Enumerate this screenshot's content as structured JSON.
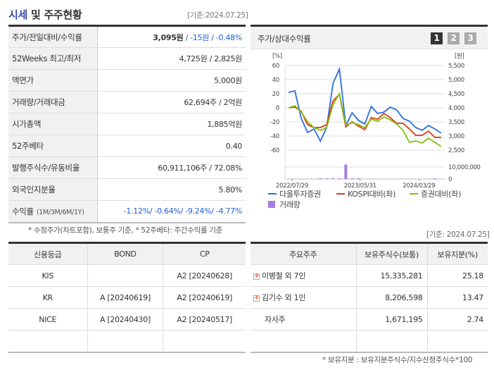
{
  "header": {
    "title_hl": "시세",
    "title_rest": " 및 주주현황",
    "date": "[기준:2024.07.25]"
  },
  "quote": [
    {
      "label": "주가/전일대비/수익률",
      "price": "3,095원",
      "rest": " / -15원 / -0.48%"
    },
    {
      "label": "52Weeks 최고/최저",
      "value": "4,725원 / 2,825원"
    },
    {
      "label": "액면가",
      "value": "5,000원"
    },
    {
      "label": "거래량/거래대금",
      "value": "62,694주 / 2억원"
    },
    {
      "label": "시가총액",
      "value": "1,885억원"
    },
    {
      "label": "52주베타",
      "value": "0.40"
    },
    {
      "label": "발행주식수/유동비율",
      "value": "60,911,106주 / 72.08%"
    },
    {
      "label": "외국인지분율",
      "value": "5.80%"
    },
    {
      "label": "수익률",
      "sub": "(1M/3M/6M/1Y)",
      "value": "-1.12%/ -0.64%/ -9.24%/ -4.77%"
    }
  ],
  "note1": "* 수정주가(차트포함), 보통주 기준, * 52주베타: 주간수익률 기준",
  "chart_panel": {
    "title": "주가/상대수익률",
    "pages": [
      "1",
      "2",
      "3"
    ],
    "active_page": "1"
  },
  "chart_data": {
    "type": "line",
    "left_unit": "[%]",
    "right_unit": "[원]",
    "left_ticks": [
      60,
      40,
      20,
      0,
      -20,
      -40,
      -60
    ],
    "right_ticks": [
      "5,500",
      "5,000",
      "4,500",
      "4,000",
      "3,500",
      "3,000",
      "2,500"
    ],
    "volume_ticks": [
      "10,000,000",
      "0"
    ],
    "ylim": [
      -60,
      60
    ],
    "x_labels": [
      "2022/07/29",
      "2023/05/31",
      "2024/03/29"
    ],
    "series": [
      {
        "name": "다올투자증권",
        "color": "#2a6de0",
        "values": [
          22,
          24,
          -15,
          -35,
          -30,
          -47,
          -28,
          35,
          55,
          -25,
          -7,
          -18,
          -23,
          2,
          -8,
          -6,
          1,
          -3,
          -15,
          -19,
          -28,
          -32,
          -25,
          -30,
          -36
        ]
      },
      {
        "name": "KOSPI대비(좌)",
        "color": "#d9380f",
        "values": [
          0,
          1,
          -5,
          -24,
          -28,
          -28,
          -24,
          10,
          19,
          -27,
          -20,
          -26,
          -31,
          -14,
          -16,
          -8,
          -14,
          -22,
          -22,
          -30,
          -39,
          -39,
          -33,
          -42,
          -42
        ]
      },
      {
        "name": "증권대비(좌)",
        "color": "#84c00c",
        "values": [
          0,
          3,
          -6,
          -20,
          -28,
          -32,
          -28,
          5,
          20,
          -25,
          -21,
          -24,
          -28,
          -16,
          -19,
          -13,
          -17,
          -23,
          -32,
          -49,
          -47,
          -50,
          -43,
          -49,
          -55
        ]
      }
    ],
    "volume": {
      "name": "거래량",
      "color": "#a57ee0",
      "values": [
        0,
        0,
        0,
        0,
        0,
        200000,
        200000,
        200000,
        200000,
        12000000,
        200000,
        200000,
        0,
        0,
        0,
        0,
        0,
        0,
        0,
        0,
        0,
        0,
        0,
        200000,
        0
      ]
    }
  },
  "date2": "[기준: 2024.07.25]",
  "credit": {
    "headers": [
      "신용등급",
      "BOND",
      "CP"
    ],
    "rows": [
      [
        "KIS",
        "",
        "A2 [20240628]"
      ],
      [
        "KR",
        "A [20240619]",
        "A2 [20240619]"
      ],
      [
        "NICE",
        "A [20240430]",
        "A2 [20240517]"
      ],
      [
        "",
        "",
        ""
      ]
    ]
  },
  "holders": {
    "headers": [
      "주요주주",
      "보유주식수(보통)",
      "보유지분(%)"
    ],
    "rows": [
      {
        "name": "이병철 외 7인",
        "expand": true,
        "shares": "15,335,281",
        "pct": "25.18"
      },
      {
        "name": "김기수 외 1인",
        "expand": true,
        "shares": "8,206,598",
        "pct": "13.47"
      },
      {
        "name": "자사주",
        "expand": false,
        "shares": "1,671,195",
        "pct": "2.74"
      },
      {
        "name": "",
        "expand": false,
        "shares": "",
        "pct": ""
      }
    ]
  },
  "note2": "* 보유지분 : 보유지분주식수/지수산정주식수*100",
  "colors": {
    "accent": "#3a4aa8",
    "blue_text": "#1f5fd6",
    "page_active": "#333333",
    "page_inactive": "#aaaaaa"
  }
}
